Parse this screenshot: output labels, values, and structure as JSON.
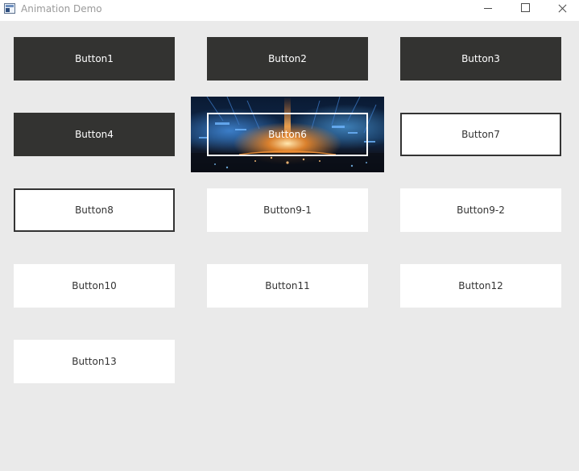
{
  "window": {
    "title": "Animation Demo",
    "icon": "app-window-icon",
    "controls": [
      "minimize-icon",
      "maximize-icon",
      "close-icon"
    ]
  },
  "buttons": {
    "b1": "Button1",
    "b2": "Button2",
    "b3": "Button3",
    "b4": "Button4",
    "b6": "Button6",
    "b7": "Button7",
    "b8": "Button8",
    "b91": "Button9-1",
    "b92": "Button9-2",
    "b10": "Button10",
    "b11": "Button11",
    "b12": "Button12",
    "b13": "Button13"
  },
  "colors": {
    "window_background": "#eaeaea",
    "dark_button": "#333331",
    "light_button": "#ffffff",
    "outline": "#333333"
  }
}
